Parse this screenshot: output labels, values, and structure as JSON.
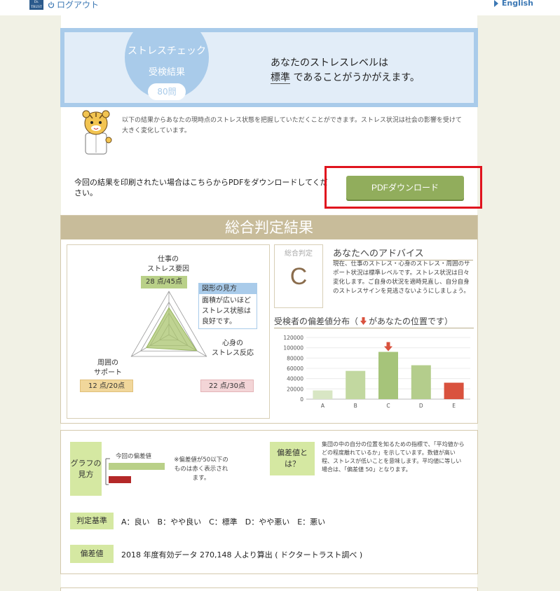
{
  "header": {
    "logo_text": "Dr. TRUST",
    "logout_label": "ログアウト",
    "language_label": "English"
  },
  "hero": {
    "circle_title": "ストレスチェック",
    "circle_subtitle": "受検結果",
    "question_count": "80問",
    "message_line1": "あなたのストレスレベルは",
    "message_level": "標準",
    "message_line2": "であることがうかがえます。"
  },
  "intro": {
    "text": "以下の結果からあなたの現時点のストレス状態を把握していただくことができます。ストレス状況は社会の影響を受けて大きく変化しています。"
  },
  "pdf": {
    "description": "今回の結果を印刷されたい場合はこちらからPDFをダウンロードしてください。",
    "button_label": "PDFダウンロード"
  },
  "summary": {
    "title": "総合判定結果",
    "radar": {
      "axes": [
        {
          "label": "仕事の\nストレス要因",
          "score_text": "28 点/45点",
          "score": 28,
          "max": 45
        },
        {
          "label": "心身の\nストレス反応",
          "score_text": "22 点/30点",
          "score": 22,
          "max": 30
        },
        {
          "label": "周囲の\nサポート",
          "score_text": "12 点/20点",
          "score": 12,
          "max": 20
        }
      ],
      "legend_title": "図形の見方",
      "legend_text": "面積が広いほどストレス状態は良好です。"
    },
    "grade": {
      "label": "総合判定",
      "value": "C"
    },
    "advice": {
      "title": "あなたへのアドバイス",
      "text": "現在、仕事のストレス・心身のストレス・周囲のサポート状況は標準レベルです。ストレス状況は日々変化します。ご自身の状況を適時見直し、自分自身のストレスサインを見逃さないようにしましょう。"
    },
    "distribution": {
      "title_prefix": "受検者の偏差値分布（",
      "title_suffix": "があなたの位置です）"
    }
  },
  "chart_data": {
    "type": "bar",
    "categories": [
      "A",
      "B",
      "C",
      "D",
      "E"
    ],
    "values": [
      17000,
      55000,
      92000,
      66000,
      32000
    ],
    "colors": [
      "#d8e6c4",
      "#c2d8a0",
      "#a6c47a",
      "#b4cd8c",
      "#d9523e"
    ],
    "ylim": [
      0,
      120000
    ],
    "yticks": [
      0,
      20000,
      40000,
      60000,
      80000,
      100000,
      120000
    ],
    "marker_category": "C",
    "grid": true
  },
  "how_to_read": {
    "graph_tag": "グラフの\n見方",
    "current_label": "今回の偏差値",
    "note": "※偏差値が50以下のものは赤く表示されます。",
    "deviation_tag": "偏差値とは？",
    "deviation_text": "集団の中の自分の位置を知るための指標で、「平均値からどの程度離れているか」を示しています。数値が高い程、ストレスが低いことを意味します。平均値に等しい場合は、「偏差値 50」となります。",
    "criteria_tag": "判定基準",
    "criteria_text": "A：良い　B：やや良い　C：標準　D：やや悪い　E：悪い",
    "hensachi_tag": "偏差値",
    "hensachi_text": "2018 年度有効データ 270,148 人より算出 ( ドクタートラスト調べ )"
  }
}
